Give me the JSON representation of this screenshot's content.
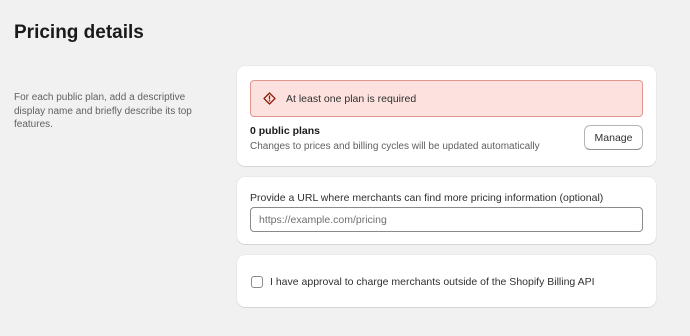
{
  "page": {
    "title": "Pricing details",
    "description": "For each public plan, add a descriptive display name and briefly describe its top features."
  },
  "plans_card": {
    "banner": {
      "icon": "alert-diamond-icon",
      "text": "At least one plan is required",
      "colors": {
        "background": "#fde1de",
        "border": "#e0968f",
        "icon": "#8e1f0b"
      }
    },
    "count_label": "0 public plans",
    "note": "Changes to prices and billing cycles will be updated automatically",
    "manage_label": "Manage"
  },
  "url_card": {
    "label": "Provide a URL where merchants can find more pricing information (optional)",
    "input_value": "",
    "input_placeholder": "https://example.com/pricing"
  },
  "approval_card": {
    "checkbox_checked": false,
    "label": "I have approval to charge merchants outside of the Shopify Billing API"
  }
}
